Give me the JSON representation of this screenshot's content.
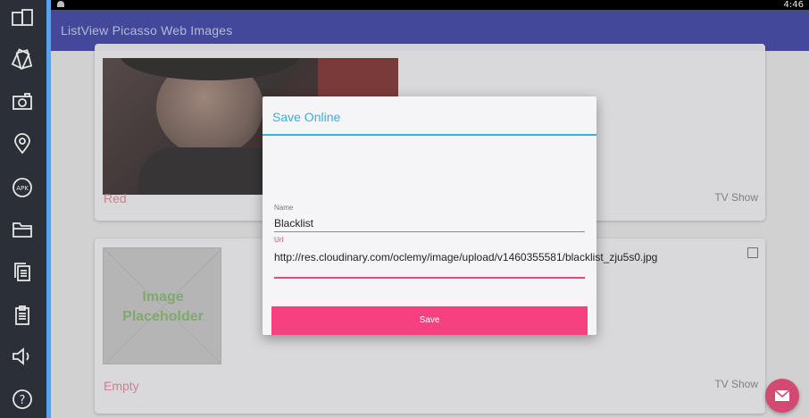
{
  "status_bar": {
    "time": "4:46"
  },
  "app_bar": {
    "title": "ListView Picasso Web Images"
  },
  "toolbar": {
    "icons": [
      "multi-window-icon",
      "rotate-icon",
      "camera-icon",
      "location-pin-icon",
      "apk-icon",
      "folder-icon",
      "copy-icon",
      "clipboard-icon",
      "volume-icon",
      "help-icon"
    ],
    "apk_label": "APK",
    "help_glyph": "?"
  },
  "cards": [
    {
      "name": "Red",
      "tag": "TV Show"
    },
    {
      "name": "Empty",
      "tag": "TV Show",
      "placeholder": "Image Placeholder"
    }
  ],
  "dialog": {
    "title": "Save Online",
    "name_label": "Name",
    "name_value": "Blacklist",
    "url_label": "Url",
    "url_value": "http://res.cloudinary.com/oclemy/image/upload/v1460355581/blacklist_zju5s0.jpg",
    "save_label": "Save"
  },
  "colors": {
    "app_bar": "#44489a",
    "accent": "#3ab0d9",
    "pink": "#f6407f",
    "card_name": "#c26b7e"
  }
}
